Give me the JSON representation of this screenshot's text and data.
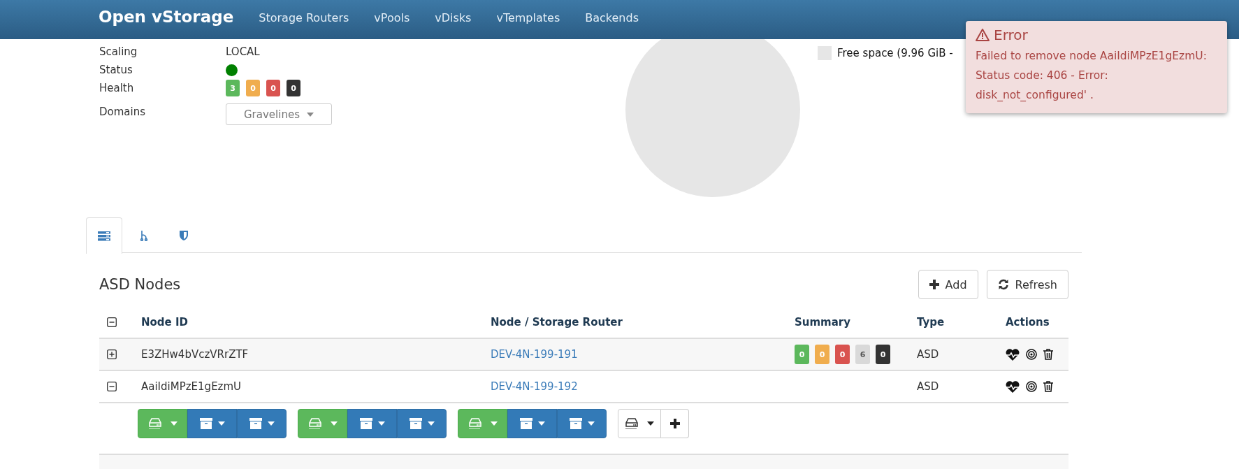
{
  "header": {
    "logo": "Open vStorage",
    "nav": [
      {
        "label": "Storage Routers"
      },
      {
        "label": "vPools"
      },
      {
        "label": "vDisks"
      },
      {
        "label": "vTemplates"
      },
      {
        "label": "Backends"
      }
    ]
  },
  "details": [
    {
      "kind": "text",
      "label": "Scaling",
      "value": "LOCAL"
    },
    {
      "kind": "status",
      "label": "Status",
      "color": "#008000"
    },
    {
      "kind": "badges",
      "label": "Health",
      "badges": [
        {
          "value": "3",
          "color": "#5cb85c"
        },
        {
          "value": "0",
          "color": "#f0ad4e"
        },
        {
          "value": "0",
          "color": "#d9534f"
        },
        {
          "value": "0",
          "color": "#333333"
        }
      ]
    },
    {
      "kind": "dropdown",
      "label": "Domains",
      "value": "Gravelines"
    }
  ],
  "usage_legend": [
    {
      "label": "Free space (9.96 GiB -",
      "color": "#e6e6e6"
    }
  ],
  "error_toast": {
    "title": "Error",
    "message": "Failed to remove node AaiIdiMPzE1gEzmU: Status code: 406 - Error: disk_not_configured' ."
  },
  "tabs": [
    {
      "selected": true
    },
    {
      "selected": false
    },
    {
      "selected": false
    }
  ],
  "panel": {
    "title": "ASD Nodes",
    "buttons": [
      {
        "kind": "add",
        "label": "Add"
      },
      {
        "kind": "refresh",
        "label": "Refresh"
      }
    ]
  },
  "table": {
    "columns": [
      "Node ID",
      "Node / Storage Router",
      "Summary",
      "Type",
      "Actions"
    ],
    "rows": [
      {
        "expanded": false,
        "node_id": "E3ZHw4bVczVRrZTF",
        "router": "DEV-4N-199-191",
        "summary": [
          {
            "value": "0",
            "color": "#5cb85c"
          },
          {
            "value": "0",
            "color": "#f0ad4e"
          },
          {
            "value": "0",
            "color": "#d9534f"
          },
          {
            "value": "6",
            "color": "#d9d9d9"
          },
          {
            "value": "0",
            "color": "#333333"
          }
        ],
        "type": "ASD"
      },
      {
        "expanded": true,
        "node_id": "AaiIdiMPzE1gEzmU",
        "router": "DEV-4N-199-192",
        "summary": [],
        "type": "ASD",
        "slots": [
          {
            "buttons": [
              {
                "kind": "disk"
              },
              {
                "kind": "box"
              },
              {
                "kind": "box"
              }
            ]
          },
          {
            "buttons": [
              {
                "kind": "disk"
              },
              {
                "kind": "box"
              },
              {
                "kind": "box"
              }
            ]
          },
          {
            "buttons": [
              {
                "kind": "disk"
              },
              {
                "kind": "box"
              },
              {
                "kind": "box"
              }
            ]
          },
          {
            "buttons": [
              {
                "kind": "new-disk"
              },
              {
                "kind": "add"
              }
            ]
          }
        ]
      }
    ]
  }
}
